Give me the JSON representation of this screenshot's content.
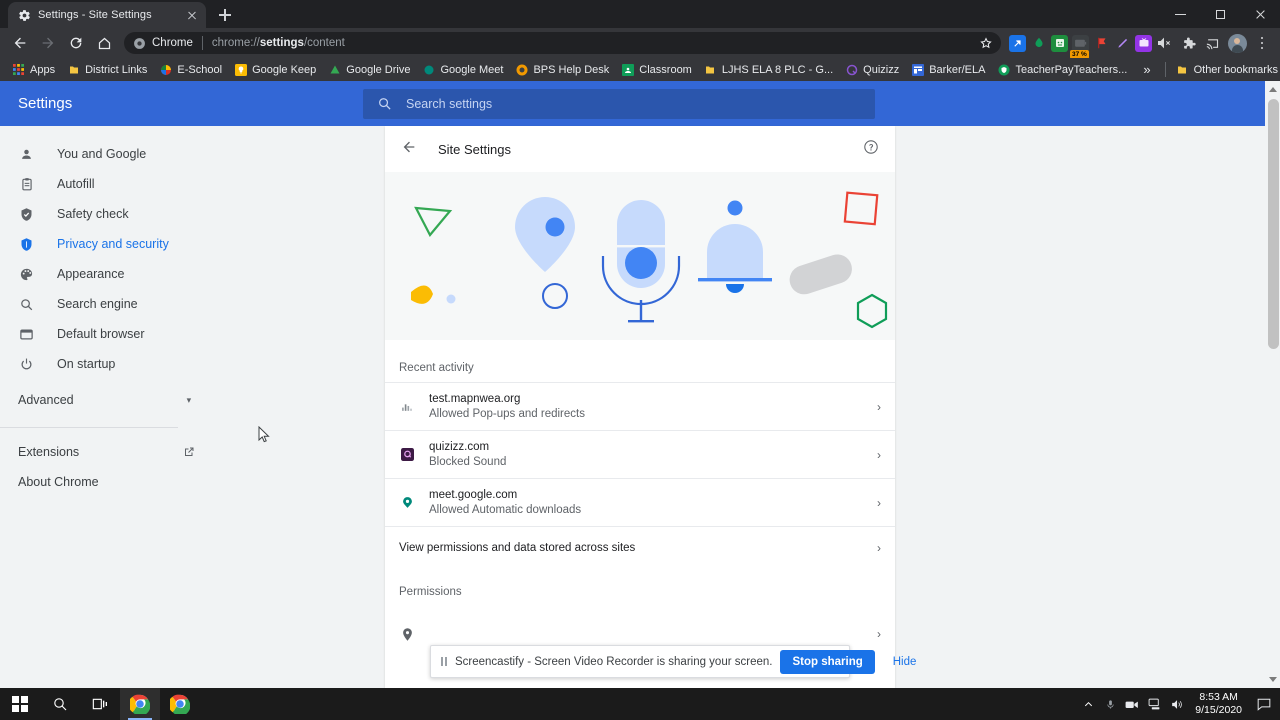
{
  "window": {
    "tab_title": "Settings - Site Settings",
    "tab_favicon": "gear-icon",
    "minimize": "—",
    "maximize": "□",
    "close": "×"
  },
  "toolbar": {
    "back": "back-arrow",
    "forward": "forward-arrow",
    "reload": "reload-icon",
    "home": "home-icon",
    "omnibox": {
      "chip_label": "Chrome",
      "url_prefix": "chrome://",
      "url_bold": "settings",
      "url_suffix": "/content",
      "full_url": "chrome://settings/content"
    },
    "bookmark_star": "star-icon",
    "extensions": [
      {
        "name": "extension-blue-arrow",
        "color": "#1a73e8",
        "glyph": "↗"
      },
      {
        "name": "extension-green-drop",
        "color": "#34a853",
        "glyph": ""
      },
      {
        "name": "extension-green-book",
        "color": "#1e8e3e",
        "glyph": ""
      },
      {
        "name": "extension-battery-saver",
        "color": "#3c4043",
        "badge": "37 %",
        "badge_color": "#f29900"
      },
      {
        "name": "extension-red-flag",
        "color": "#ea4335",
        "glyph": ""
      },
      {
        "name": "extension-purple-pen",
        "color": "#a142f4",
        "glyph": ""
      },
      {
        "name": "extension-purple-tv",
        "color": "#9334e6",
        "glyph": "TV"
      }
    ],
    "mute_icon": "speaker-muted-icon",
    "puzzle_icon": "extensions-puzzle-icon",
    "cast_icon": "cast-icon",
    "avatar": "profile-avatar",
    "menu": "three-dot-menu-icon"
  },
  "bookmarks": {
    "items": [
      {
        "label": "Apps",
        "icon": "apps-grid-icon",
        "color": "#8ab4f8"
      },
      {
        "label": "District Links",
        "icon": "folder-icon",
        "color": "#f4c542"
      },
      {
        "label": "E-School",
        "icon": "pie-icon",
        "color": "#d93025"
      },
      {
        "label": "Google Keep",
        "icon": "keep-bulb-icon",
        "color": "#fbbc04"
      },
      {
        "label": "Google Drive",
        "icon": "drive-triangle-icon",
        "color": "#34a853"
      },
      {
        "label": "Google Meet",
        "icon": "meet-icon",
        "color": "#00897b"
      },
      {
        "label": "BPS Help Desk",
        "icon": "helpdesk-icon",
        "color": "#f29900"
      },
      {
        "label": "Classroom",
        "icon": "classroom-icon",
        "color": "#0f9d58"
      },
      {
        "label": "LJHS ELA 8 PLC - G...",
        "icon": "folder-icon",
        "color": "#f4c542"
      },
      {
        "label": "Quizizz",
        "icon": "quizizz-icon",
        "color": "#8854d0"
      },
      {
        "label": "Barker/ELA",
        "icon": "sites-icon",
        "color": "#3367d6"
      },
      {
        "label": "TeacherPayTeachers...",
        "icon": "tpt-icon",
        "color": "#0f9d58"
      }
    ],
    "overflow": "»",
    "other_bookmarks": {
      "label": "Other bookmarks",
      "icon": "folder-icon"
    }
  },
  "settings": {
    "brand": "Settings",
    "search": {
      "placeholder": "Search settings",
      "value": "",
      "icon": "search-icon"
    },
    "nav": [
      {
        "label": "You and Google",
        "icon": "person-icon",
        "active": false
      },
      {
        "label": "Autofill",
        "icon": "clipboard-icon",
        "active": false
      },
      {
        "label": "Safety check",
        "icon": "shield-check-icon",
        "active": false
      },
      {
        "label": "Privacy and security",
        "icon": "shield-icon",
        "active": true
      },
      {
        "label": "Appearance",
        "icon": "palette-icon",
        "active": false
      },
      {
        "label": "Search engine",
        "icon": "search-icon",
        "active": false
      },
      {
        "label": "Default browser",
        "icon": "browser-window-icon",
        "active": false
      },
      {
        "label": "On startup",
        "icon": "power-icon",
        "active": false
      }
    ],
    "advanced": {
      "label": "Advanced",
      "caret": "▾"
    },
    "footer": [
      {
        "label": "Extensions",
        "icon": "external-link-icon",
        "has_external": true
      },
      {
        "label": "About Chrome",
        "icon": "",
        "has_external": false
      }
    ]
  },
  "main": {
    "back_label": "back-arrow",
    "title": "Site Settings",
    "help_icon": "help-circle-icon",
    "recent_activity": {
      "label": "Recent activity",
      "rows": [
        {
          "site": "test.mapnwea.org",
          "detail": "Allowed Pop-ups and redirects",
          "icon": "chart-favicon",
          "color": "#5f6368"
        },
        {
          "site": "quizizz.com",
          "detail": "Blocked Sound",
          "icon": "quizizz-favicon",
          "color": "#3d1a45"
        },
        {
          "site": "meet.google.com",
          "detail": "Allowed Automatic downloads",
          "icon": "meet-favicon",
          "color": "#00897b"
        }
      ]
    },
    "view_permissions": {
      "label": "View permissions and data stored across sites",
      "chevron": "›"
    },
    "permissions": {
      "label": "Permissions",
      "rows": [
        {
          "label": "Location",
          "icon": "location-pin-icon"
        }
      ]
    },
    "chevron": "›"
  },
  "share_notification": {
    "pause_icon": "pause-icon",
    "message": "Screencastify - Screen Video Recorder is sharing your screen.",
    "stop_label": "Stop sharing",
    "hide_label": "Hide"
  },
  "taskbar": {
    "start": "windows-start-icon",
    "search": "search-icon",
    "task_view": "task-view-icon",
    "apps": [
      {
        "name": "chrome-window-1",
        "active": true
      },
      {
        "name": "chrome-window-2",
        "active": false
      }
    ],
    "tray": [
      {
        "name": "show-hidden-icons-chevron",
        "glyph": "∧"
      },
      {
        "name": "microphone-icon",
        "glyph": ""
      },
      {
        "name": "camera-icon",
        "glyph": ""
      },
      {
        "name": "network-icon",
        "glyph": ""
      },
      {
        "name": "volume-icon",
        "glyph": ""
      }
    ],
    "time": "8:53 AM",
    "date": "9/15/2020",
    "notification_icon": "action-center-icon"
  },
  "colors": {
    "accent_blue": "#1a73e8",
    "header_blue": "#3367d6",
    "chrome_dark": "#35363a",
    "chrome_darker": "#202124",
    "illus_light_blue": "#c6dafc",
    "illus_blue": "#4285f4",
    "illus_green": "#34a853",
    "illus_yellow": "#fbbc04",
    "illus_red": "#ea4335",
    "illus_gray": "#d2d3d5"
  }
}
